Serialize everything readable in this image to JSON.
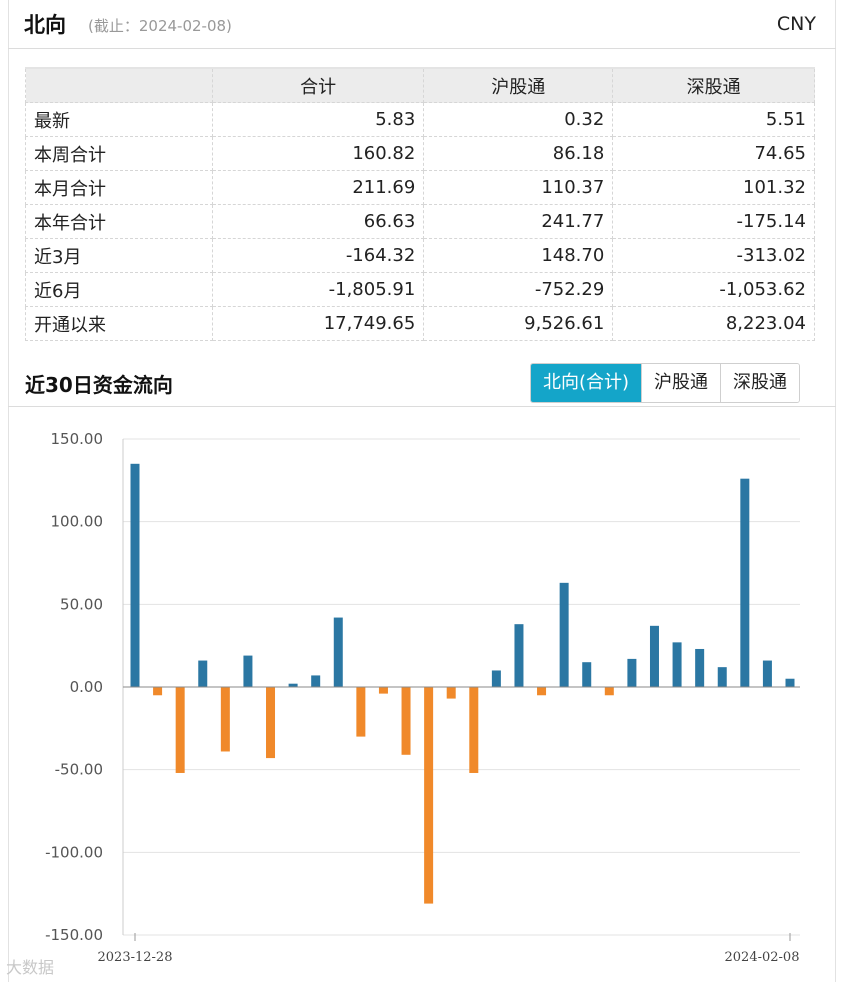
{
  "header": {
    "title": "北向",
    "asof": "(截止：2024-02-08)",
    "currency": "CNY"
  },
  "table": {
    "columns": [
      "",
      "合计",
      "沪股通",
      "深股通"
    ],
    "rows": [
      {
        "label": "最新",
        "total": "5.83",
        "sh": "0.32",
        "sz": "5.51"
      },
      {
        "label": "本周合计",
        "total": "160.82",
        "sh": "86.18",
        "sz": "74.65"
      },
      {
        "label": "本月合计",
        "total": "211.69",
        "sh": "110.37",
        "sz": "101.32"
      },
      {
        "label": "本年合计",
        "total": "66.63",
        "sh": "241.77",
        "sz": "-175.14"
      },
      {
        "label": "近3月",
        "total": "-164.32",
        "sh": "148.70",
        "sz": "-313.02"
      },
      {
        "label": "近6月",
        "total": "-1,805.91",
        "sh": "-752.29",
        "sz": "-1,053.62"
      },
      {
        "label": "开通以来",
        "total": "17,749.65",
        "sh": "9,526.61",
        "sz": "8,223.04"
      }
    ]
  },
  "section": {
    "title": "近30日资金流向",
    "tabs": [
      {
        "label": "北向(合计)",
        "active": true
      },
      {
        "label": "沪股通",
        "active": false
      },
      {
        "label": "深股通",
        "active": false
      }
    ]
  },
  "watermark": "大数据",
  "chart_data": {
    "type": "bar",
    "ylim": [
      -150,
      150
    ],
    "yticks": [
      "150.00",
      "100.00",
      "50.00",
      "0.00",
      "-50.00",
      "-100.00",
      "-150.00"
    ],
    "ytick_values": [
      150,
      100,
      50,
      0,
      -50,
      -100,
      -150
    ],
    "x_first_label": "2023-12-28",
    "x_last_label": "2024-02-08",
    "positive_color": "#2b77a3",
    "negative_color": "#f0892a",
    "grid": true,
    "values": [
      135,
      -5,
      -52,
      16,
      -39,
      19,
      -43,
      2,
      7,
      42,
      -30,
      -4,
      -41,
      -131,
      -7,
      -52,
      10,
      38,
      -5,
      63,
      15,
      -5,
      17,
      37,
      27,
      23,
      12,
      126,
      16,
      5
    ]
  }
}
